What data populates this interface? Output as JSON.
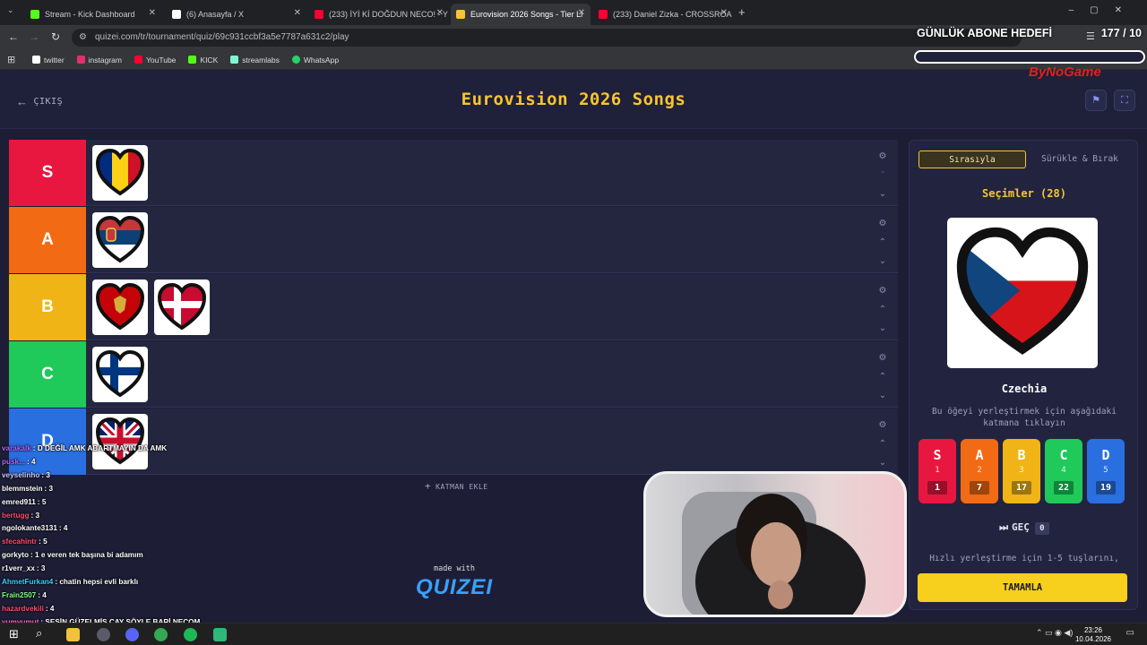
{
  "browser": {
    "tabs": [
      {
        "title": "Stream - Kick Dashboard",
        "icon": "kick-icon",
        "color": "#53fc18",
        "active": false
      },
      {
        "title": "(6) Anasayfa / X",
        "icon": "x-icon",
        "color": "#ffffff",
        "active": false
      },
      {
        "title": "(233) İYİ Kİ DOĞDUN NECO! - Y",
        "icon": "youtube-icon",
        "color": "#ff0033",
        "active": false
      },
      {
        "title": "Eurovision 2026 Songs - Tier Li",
        "icon": "quizei-icon",
        "color": "#f7c531",
        "active": true
      },
      {
        "title": "(233) Daniel Zizka - CROSSROA",
        "icon": "youtube-icon",
        "color": "#ff0033",
        "active": false
      }
    ],
    "url": "quizei.com/tr/tournament/quiz/69c931ccbf3a5e7787a631c2/play",
    "bookmarks": [
      {
        "label": "twitter",
        "color": "#ffffff"
      },
      {
        "label": "instagram",
        "color": "#e1306c"
      },
      {
        "label": "YouTube",
        "color": "#ff0033"
      },
      {
        "label": "KICK",
        "color": "#53fc18"
      },
      {
        "label": "streamlabs",
        "color": "#80f5d2"
      },
      {
        "label": "WhatsApp",
        "color": "#25d366"
      }
    ]
  },
  "app": {
    "title": "Eurovision 2026 Songs",
    "exit_label": "ÇIKIŞ",
    "add_tier_label": "KATMAN EKLE",
    "made_with": "made with",
    "brand": "QUIZEI",
    "tiers": [
      {
        "label": "S",
        "color": "#e8173f",
        "items": [
          "romania"
        ]
      },
      {
        "label": "A",
        "color": "#f26a14",
        "items": [
          "serbia"
        ]
      },
      {
        "label": "B",
        "color": "#f0b417",
        "items": [
          "montenegro",
          "denmark"
        ]
      },
      {
        "label": "C",
        "color": "#1fc95a",
        "items": [
          "finland"
        ]
      },
      {
        "label": "D",
        "color": "#2a6fe0",
        "items": [
          "united-kingdom"
        ]
      }
    ]
  },
  "sidebar": {
    "mode_ordered": "Sırasıyla",
    "mode_drag": "Sürükle & Bırak",
    "choices_label": "Seçimler (28)",
    "current_item": "Czechia",
    "hint": "Bu öğeyi yerleştirmek için aşağıdaki katmana tıklayın",
    "tier_buttons": [
      {
        "label": "S",
        "key": "1",
        "count": "1",
        "color": "#e8173f"
      },
      {
        "label": "A",
        "key": "2",
        "count": "7",
        "color": "#f26a14"
      },
      {
        "label": "B",
        "key": "3",
        "count": "17",
        "color": "#f0b417"
      },
      {
        "label": "C",
        "key": "4",
        "count": "22",
        "color": "#1fc95a"
      },
      {
        "label": "D",
        "key": "5",
        "count": "19",
        "color": "#2a6fe0"
      }
    ],
    "skip_label": "GEÇ",
    "skip_count": "0",
    "shortcut_tip": "Hızlı yerleştirme için 1-5 tuşlarını,",
    "finish_label": "TAMAMLA"
  },
  "overlay": {
    "goal_title": "GÜNLÜK ABONE HEDEFİ",
    "goal_count": "177 / 10",
    "sponsor": "ByNoGame",
    "chat": [
      {
        "user": "varakalk",
        "msg": "D DEĞİL AMK ABARTMAYIN DA AMK",
        "color": "#b266ff"
      },
      {
        "user": "pusk...",
        "msg": "4",
        "color": "#b266ff"
      },
      {
        "user": "veyselinho",
        "msg": "3",
        "color": "#ffffff"
      },
      {
        "user": "blemmstein",
        "msg": "3",
        "color": "#ffffff"
      },
      {
        "user": "emred911",
        "msg": "5",
        "color": "#ffffff"
      },
      {
        "user": "bertugg",
        "msg": "3",
        "color": "#ff4d6d"
      },
      {
        "user": "ngolokante3131",
        "msg": "4",
        "color": "#ffffff"
      },
      {
        "user": "sfecahintr",
        "msg": "5",
        "color": "#ff4d6d"
      },
      {
        "user": "gorkyto",
        "msg": "1 e veren tek başına bi adamım",
        "color": "#ffffff"
      },
      {
        "user": "r1verr_xx",
        "msg": "3",
        "color": "#ffffff"
      },
      {
        "user": "AhmetFurkan4",
        "msg": "chatin hepsi evli barklı",
        "color": "#32d2ff"
      },
      {
        "user": "Frain2507",
        "msg": "4",
        "color": "#7dff7d"
      },
      {
        "user": "hazardvekili",
        "msg": "4",
        "color": "#ff4d6d"
      },
      {
        "user": "yumyumut",
        "msg": "SESİN GÜZELMİŞ ÇAY SÖYLE BARİ NECOM",
        "color": "#ff66c4"
      }
    ]
  },
  "taskbar": {
    "time": "23:26",
    "date": "10.04.2026"
  }
}
